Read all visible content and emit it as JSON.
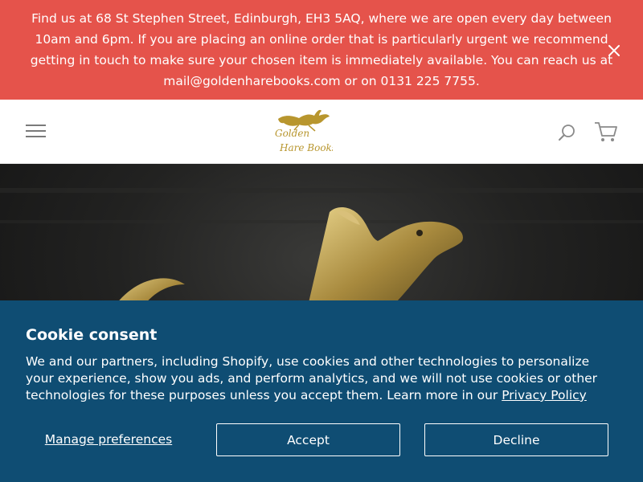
{
  "announcement": {
    "text": "Find us at 68 St Stephen Street, Edinburgh, EH3 5AQ, where we are open every day between 10am and 6pm. If you are placing an online order that is particularly urgent we recommend getting in touch to make sure your chosen item is immediately available. You can reach us at mail@goldenharebooks.com or on 0131 225 7755.",
    "background": "#e5534b",
    "close_icon": "close-icon"
  },
  "header": {
    "logo_text": "Golden Hare Books",
    "menu_icon": "hamburger-menu-icon",
    "search_icon": "search-icon",
    "cart_icon": "cart-icon",
    "logo_color": "#b8962e"
  },
  "hero": {
    "image": "golden hare figurine on dark background"
  },
  "cookie": {
    "title": "Cookie consent",
    "text_before_link": "We and our partners, including Shopify, use cookies and other technologies to personalize your experience, show you ads, and perform analytics, and we will not use cookies or other technologies for these purposes unless you accept them. Learn more in our ",
    "link_label": "Privacy Policy",
    "manage_label": "Manage preferences",
    "accept_label": "Accept",
    "decline_label": "Decline",
    "background": "#0f4d73"
  }
}
